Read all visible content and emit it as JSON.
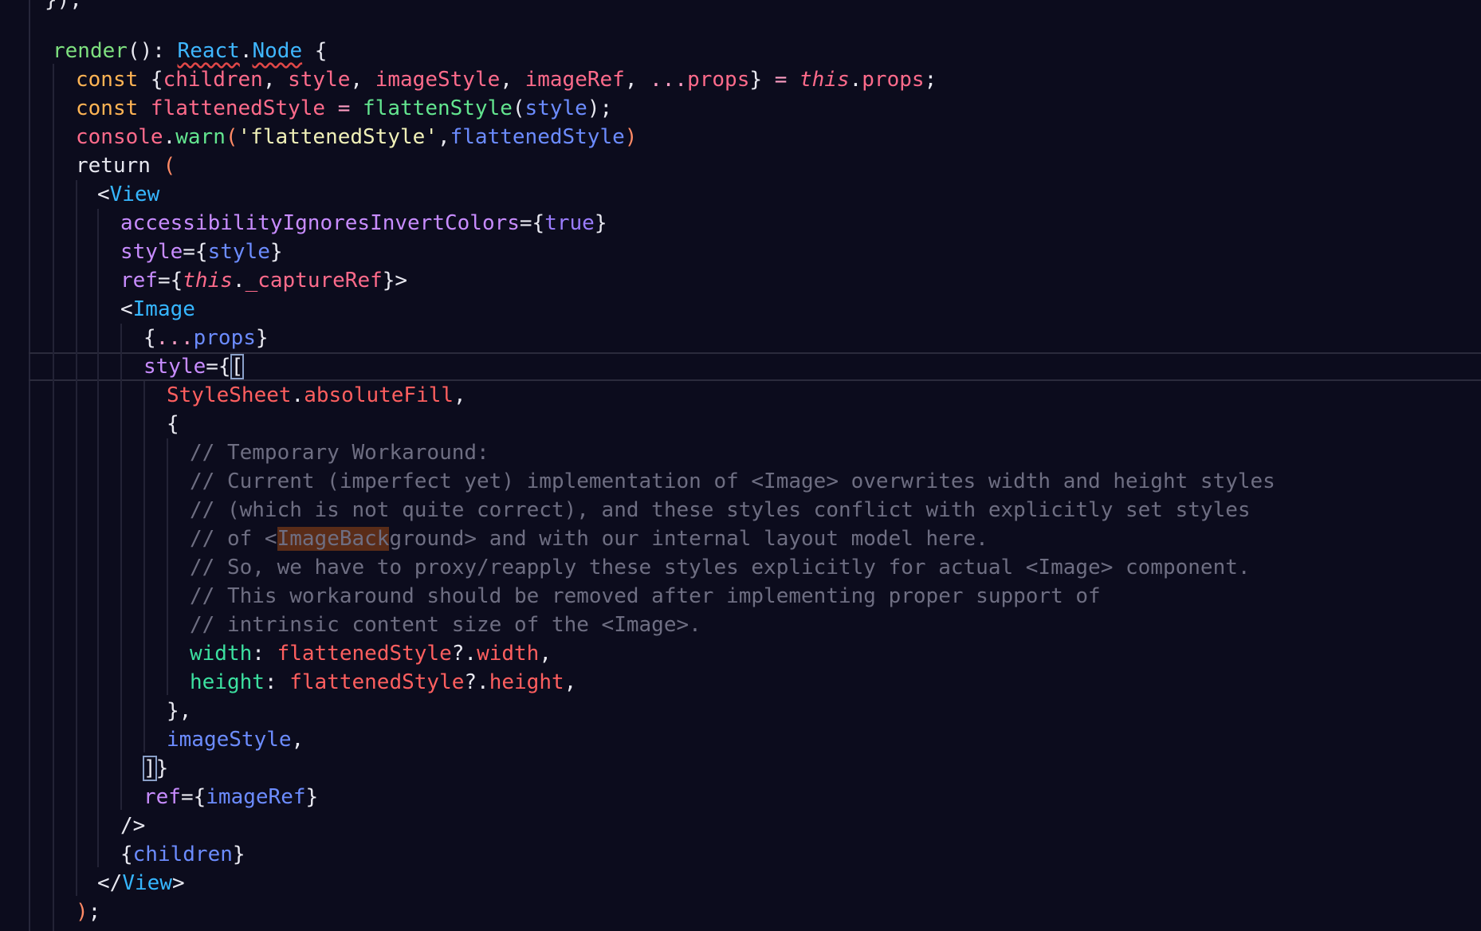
{
  "editor": {
    "lines": [
      {
        "tokens": [
          [
            "punc",
            "}"
          ],
          [
            "punc",
            ");"
          ]
        ]
      },
      {
        "tokens": []
      },
      {
        "tokens": [
          [
            "fn",
            "render"
          ],
          [
            "punc",
            "(): "
          ],
          [
            "type",
            "React"
          ],
          [
            "punc",
            "."
          ],
          [
            "type",
            "Node"
          ],
          [
            "punc",
            " {"
          ]
        ]
      },
      {
        "tokens": [
          [
            "kw",
            "const "
          ],
          [
            "punc",
            "{"
          ],
          [
            "var",
            "children"
          ],
          [
            "punc",
            ", "
          ],
          [
            "var",
            "style"
          ],
          [
            "punc",
            ", "
          ],
          [
            "var",
            "imageStyle"
          ],
          [
            "punc",
            ", "
          ],
          [
            "var",
            "imageRef"
          ],
          [
            "punc",
            ", "
          ],
          [
            "op",
            "..."
          ],
          [
            "var",
            "props"
          ],
          [
            "punc",
            "} "
          ],
          [
            "op",
            "= "
          ],
          [
            "this",
            "this"
          ],
          [
            "punc",
            "."
          ],
          [
            "prop",
            "props"
          ],
          [
            "punc",
            ";"
          ]
        ]
      },
      {
        "tokens": [
          [
            "kw",
            "const "
          ],
          [
            "var",
            "flattenedStyle"
          ],
          [
            "op",
            " = "
          ],
          [
            "call",
            "flattenStyle"
          ],
          [
            "punc",
            "("
          ],
          [
            "param",
            "style"
          ],
          [
            "punc",
            ");"
          ]
        ]
      },
      {
        "tokens": [
          [
            "var",
            "console"
          ],
          [
            "punc",
            "."
          ],
          [
            "call",
            "warn"
          ],
          [
            "paren",
            "("
          ],
          [
            "str",
            "'flattenedStyle'"
          ],
          [
            "punc",
            ","
          ],
          [
            "param",
            "flattenedStyle"
          ],
          [
            "paren",
            ")"
          ]
        ]
      },
      {
        "tokens": [
          [
            "kw2",
            "return "
          ],
          [
            "paren",
            "("
          ]
        ]
      },
      {
        "tokens": [
          [
            "punc",
            "<"
          ],
          [
            "jsx",
            "View"
          ]
        ]
      },
      {
        "tokens": [
          [
            "attr",
            "accessibilityIgnoresInvertColors"
          ],
          [
            "punc",
            "={"
          ],
          [
            "bool",
            "true"
          ],
          [
            "punc",
            "}"
          ]
        ]
      },
      {
        "tokens": [
          [
            "attr",
            "style"
          ],
          [
            "punc",
            "={"
          ],
          [
            "param",
            "style"
          ],
          [
            "punc",
            "}"
          ]
        ]
      },
      {
        "tokens": [
          [
            "attr",
            "ref"
          ],
          [
            "punc",
            "={"
          ],
          [
            "this",
            "this"
          ],
          [
            "punc",
            "."
          ],
          [
            "prop",
            "_captureRef"
          ],
          [
            "punc",
            "}>"
          ]
        ]
      },
      {
        "tokens": [
          [
            "punc",
            "<"
          ],
          [
            "jsx",
            "Image"
          ]
        ]
      },
      {
        "tokens": [
          [
            "punc",
            "{"
          ],
          [
            "op",
            "..."
          ],
          [
            "param",
            "props"
          ],
          [
            "punc",
            "}"
          ]
        ]
      },
      {
        "tokens": [
          [
            "attr",
            "style"
          ],
          [
            "punc",
            "={"
          ],
          [
            "cursor",
            "["
          ]
        ]
      },
      {
        "tokens": [
          [
            "red",
            "StyleSheet"
          ],
          [
            "punc",
            "."
          ],
          [
            "red",
            "absoluteFill"
          ],
          [
            "punc",
            ","
          ]
        ]
      },
      {
        "tokens": [
          [
            "punc",
            "{"
          ]
        ]
      },
      {
        "tokens": [
          [
            "comment",
            "// Temporary Workaround:"
          ]
        ]
      },
      {
        "tokens": [
          [
            "comment",
            "// Current (imperfect yet) implementation of <Image> overwrites width and height styles"
          ]
        ]
      },
      {
        "tokens": [
          [
            "comment",
            "// (which is not quite correct), and these styles conflict with explicitly set styles"
          ]
        ]
      },
      {
        "tokens": [
          [
            "comment",
            "// of <"
          ],
          [
            "hlcomment",
            "ImageBack"
          ],
          [
            "comment",
            "ground> and with our internal layout model here."
          ]
        ]
      },
      {
        "tokens": [
          [
            "comment",
            "// So, we have to proxy/reapply these styles explicitly for actual <Image> component."
          ]
        ]
      },
      {
        "tokens": [
          [
            "comment",
            "// This workaround should be removed after implementing proper support of"
          ]
        ]
      },
      {
        "tokens": [
          [
            "comment",
            "// intrinsic content size of the <Image>."
          ]
        ]
      },
      {
        "tokens": [
          [
            "green",
            "width"
          ],
          [
            "punc",
            ": "
          ],
          [
            "red",
            "flattenedStyle"
          ],
          [
            "punc",
            "?."
          ],
          [
            "red",
            "width"
          ],
          [
            "punc",
            ","
          ]
        ]
      },
      {
        "tokens": [
          [
            "green",
            "height"
          ],
          [
            "punc",
            ": "
          ],
          [
            "red",
            "flattenedStyle"
          ],
          [
            "punc",
            "?."
          ],
          [
            "red",
            "height"
          ],
          [
            "punc",
            ","
          ]
        ]
      },
      {
        "tokens": [
          [
            "punc",
            "},"
          ]
        ]
      },
      {
        "tokens": [
          [
            "param",
            "imageStyle"
          ],
          [
            "punc",
            ","
          ]
        ]
      },
      {
        "tokens": [
          [
            "cursor",
            "]"
          ],
          [
            "punc",
            "}"
          ]
        ]
      },
      {
        "tokens": [
          [
            "attr",
            "ref"
          ],
          [
            "punc",
            "={"
          ],
          [
            "param",
            "imageRef"
          ],
          [
            "punc",
            "}"
          ]
        ]
      },
      {
        "tokens": [
          [
            "punc",
            "/>"
          ]
        ]
      },
      {
        "tokens": [
          [
            "punc",
            "{"
          ],
          [
            "param",
            "children"
          ],
          [
            "punc",
            "}"
          ]
        ]
      },
      {
        "tokens": [
          [
            "punc",
            "</"
          ],
          [
            "jsx",
            "View"
          ],
          [
            "punc",
            ">"
          ]
        ]
      },
      {
        "tokens": [
          [
            "paren",
            ")"
          ],
          [
            "punc",
            ";"
          ]
        ]
      }
    ]
  }
}
